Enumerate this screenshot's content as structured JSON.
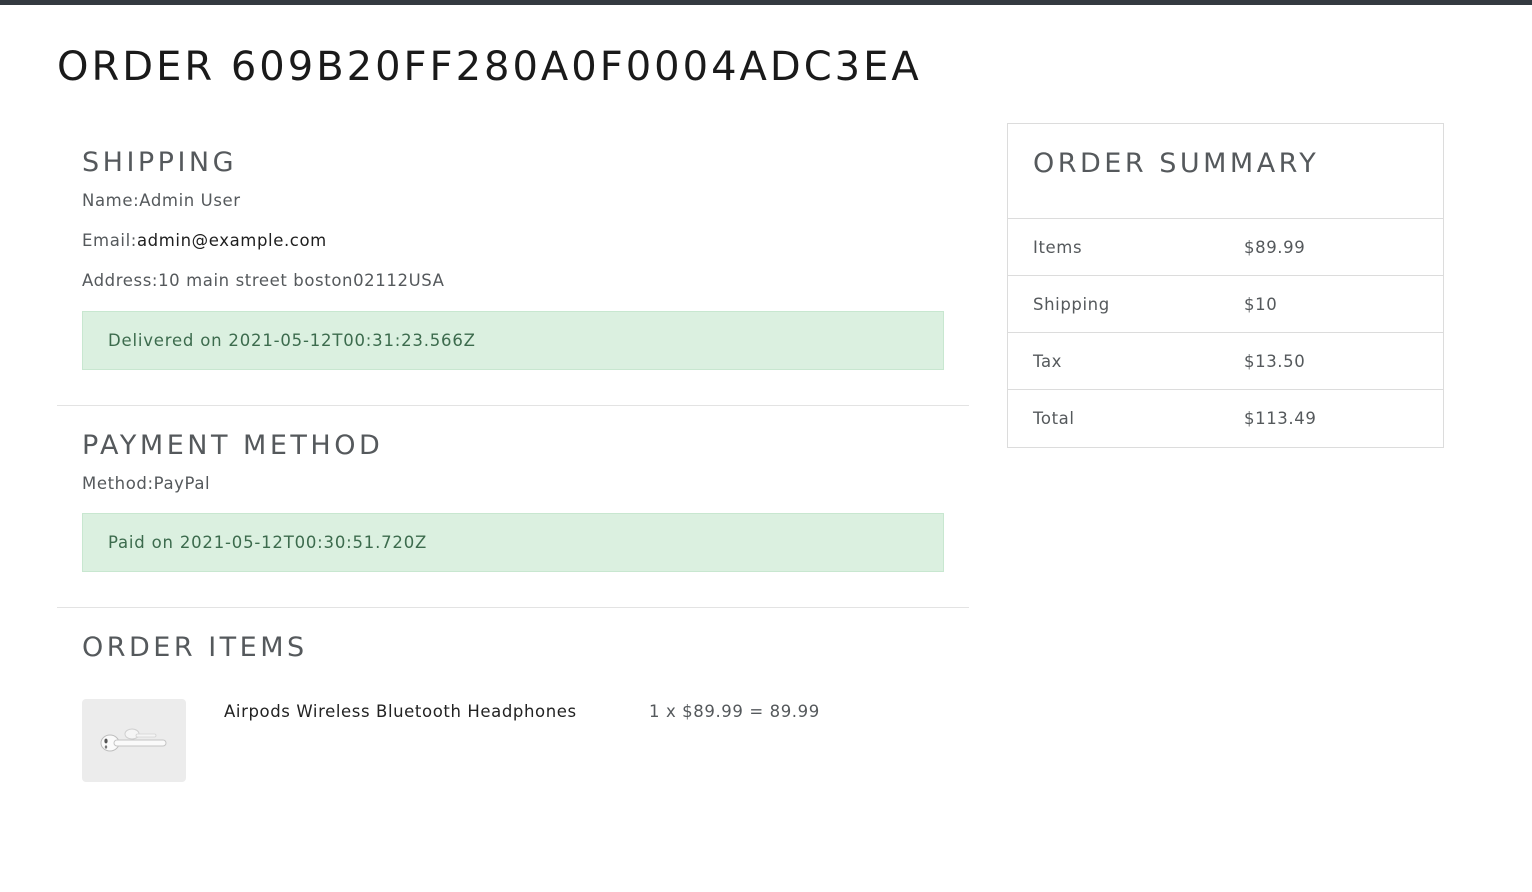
{
  "order": {
    "title": "ORDER 609B20FF280A0F0004ADC3EA"
  },
  "shipping": {
    "heading": "SHIPPING",
    "name_label": "Name:",
    "name_value": "Admin User",
    "email_label": "Email:",
    "email_value": "admin@example.com",
    "address_label": "Address:",
    "address_value": "10 main street boston02112USA",
    "status": "Delivered on 2021-05-12T00:31:23.566Z"
  },
  "payment": {
    "heading": "PAYMENT METHOD",
    "method_label": "Method:",
    "method_value": "PayPal",
    "status": "Paid on 2021-05-12T00:30:51.720Z"
  },
  "order_items": {
    "heading": "ORDER ITEMS",
    "items": [
      {
        "name": "Airpods Wireless Bluetooth Headphones",
        "price_line": "1 x $89.99 = 89.99",
        "image_icon": "airpods-image"
      }
    ]
  },
  "summary": {
    "heading": "ORDER SUMMARY",
    "rows": [
      {
        "label": "Items",
        "value": "$89.99"
      },
      {
        "label": "Shipping",
        "value": "$10"
      },
      {
        "label": "Tax",
        "value": "$13.50"
      },
      {
        "label": "Total",
        "value": "$113.49"
      }
    ]
  },
  "colors": {
    "topbar": "#343a40",
    "alert_bg": "#dbf0e0",
    "alert_text": "#3c6b4d"
  }
}
